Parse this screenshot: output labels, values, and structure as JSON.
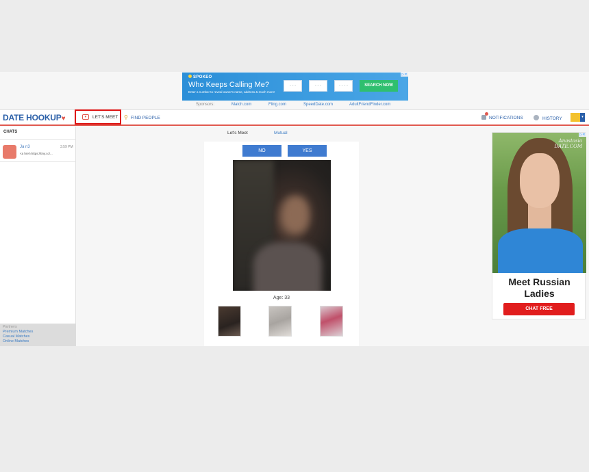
{
  "top_ad": {
    "brand": "SPOKEO",
    "headline": "Who Keeps Calling Me?",
    "subtext": "Enter a number to reveal owner's name, address & much more!",
    "phone_parts": [
      "- - -",
      "- - -",
      "- - - -"
    ],
    "button": "SEARCH NOW",
    "adchoices": "▷✕"
  },
  "sponsors": {
    "label": "Sponsors:",
    "links": [
      "Match.com",
      "Fling.com",
      "SpeedDate.com",
      "AdultFriendFinder.com"
    ]
  },
  "nav": {
    "logo": "DATE HOOKUP",
    "logo_heart": "♥",
    "lets_meet": "LET'S MEET",
    "find_people": "FIND PEOPLE",
    "notifications": "NOTIFICATIONS",
    "history": "HISTORY",
    "avatar_caret": "▾"
  },
  "sidebar": {
    "title": "CHATS",
    "chats": [
      {
        "name": "Ja          n3",
        "time": "3:59 PM",
        "message": "<a href=https://tiny.cc/..."
      }
    ],
    "partners_title": "Partners",
    "partner_links": [
      "Premium Matches",
      "Casual Matches",
      "Online Matches"
    ]
  },
  "main": {
    "tabs": [
      "Let's Meet",
      "Mutual"
    ],
    "no_label": "NO",
    "yes_label": "YES",
    "age": "Age: 33"
  },
  "right_ad": {
    "watermark_line1": "Anastasia",
    "watermark_line2": "DATE.COM",
    "headline": "Meet Russian Ladies",
    "button": "CHAT FREE",
    "adchoices": "▷✕"
  },
  "colors": {
    "brand_blue": "#2a5fa8",
    "accent_red": "#e0584e",
    "button_blue": "#3f7bd0",
    "cta_red": "#e11d1d",
    "ad_green": "#2fbf6f"
  }
}
